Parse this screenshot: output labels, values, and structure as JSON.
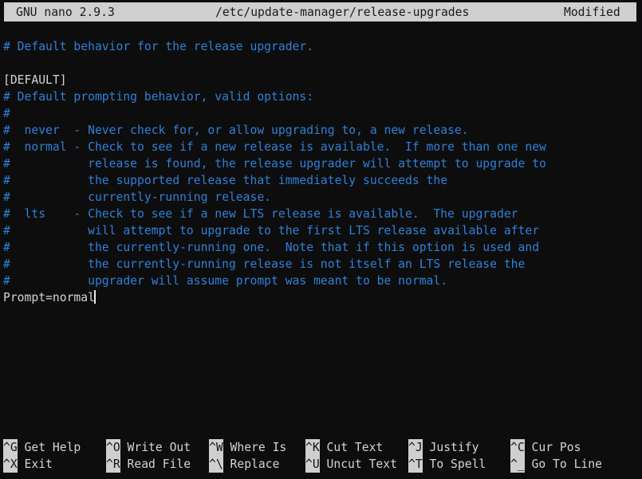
{
  "titlebar": {
    "version": "GNU nano 2.9.3",
    "filename": "/etc/update-manager/release-upgrades",
    "status": "Modified"
  },
  "editor": {
    "cursor": {
      "line_index": 16,
      "column_after_text": "Prompt=normal"
    },
    "lines": [
      {
        "text": "# Default behavior for the release upgrader.",
        "style": "comment"
      },
      {
        "text": "",
        "style": "comment"
      },
      {
        "text": "[DEFAULT]",
        "style": "plain"
      },
      {
        "text": "# Default prompting behavior, valid options:",
        "style": "comment"
      },
      {
        "text": "#",
        "style": "comment"
      },
      {
        "text": "#  never  - Never check for, or allow upgrading to, a new release.",
        "style": "comment"
      },
      {
        "text": "#  normal - Check to see if a new release is available.  If more than one new",
        "style": "comment"
      },
      {
        "text": "#           release is found, the release upgrader will attempt to upgrade to",
        "style": "comment"
      },
      {
        "text": "#           the supported release that immediately succeeds the",
        "style": "comment"
      },
      {
        "text": "#           currently-running release.",
        "style": "comment"
      },
      {
        "text": "#  lts    - Check to see if a new LTS release is available.  The upgrader",
        "style": "comment"
      },
      {
        "text": "#           will attempt to upgrade to the first LTS release available after",
        "style": "comment"
      },
      {
        "text": "#           the currently-running one.  Note that if this option is used and",
        "style": "comment"
      },
      {
        "text": "#           the currently-running release is not itself an LTS release the",
        "style": "comment"
      },
      {
        "text": "#           upgrader will assume prompt was meant to be normal.",
        "style": "comment"
      },
      {
        "text": "Prompt=normal",
        "style": "plain"
      }
    ]
  },
  "shortcuts": [
    {
      "key": "^G",
      "label": "Get Help",
      "col": 0,
      "row": 0
    },
    {
      "key": "^X",
      "label": "Exit",
      "col": 0,
      "row": 1
    },
    {
      "key": "^O",
      "label": "Write Out",
      "col": 1,
      "row": 0
    },
    {
      "key": "^R",
      "label": "Read File",
      "col": 1,
      "row": 1
    },
    {
      "key": "^W",
      "label": "Where Is",
      "col": 2,
      "row": 0
    },
    {
      "key": "^\\",
      "label": "Replace",
      "col": 2,
      "row": 1
    },
    {
      "key": "^K",
      "label": "Cut Text",
      "col": 3,
      "row": 0
    },
    {
      "key": "^U",
      "label": "Uncut Text",
      "col": 3,
      "row": 1
    },
    {
      "key": "^J",
      "label": "Justify",
      "col": 4,
      "row": 0
    },
    {
      "key": "^T",
      "label": "To Spell",
      "col": 4,
      "row": 1
    },
    {
      "key": "^C",
      "label": "Cur Pos",
      "col": 5,
      "row": 0
    },
    {
      "key": "^_",
      "label": "Go To Line",
      "col": 5,
      "row": 1
    }
  ],
  "colors": {
    "background": "#0d0d0d",
    "comment_text": "#2f80d8",
    "normal_text": "#d4d4d4",
    "bar_background": "#cfcfcf",
    "bar_text": "#141414"
  }
}
